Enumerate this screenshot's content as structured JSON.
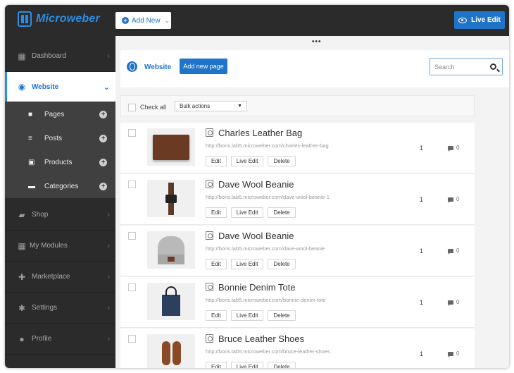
{
  "topbar": {
    "logo_text": "Microweber",
    "add_new_label": "Add New",
    "live_edit_label": "Live Edit"
  },
  "sidebar": {
    "items": [
      {
        "label": "Dashboard",
        "icon": "dashboard-icon"
      },
      {
        "label": "Website",
        "icon": "globe-icon"
      },
      {
        "label": "Shop",
        "icon": "shop-icon"
      },
      {
        "label": "My Modules",
        "icon": "modules-icon"
      },
      {
        "label": "Marketplace",
        "icon": "puzzle-icon"
      },
      {
        "label": "Settings",
        "icon": "gear-icon"
      },
      {
        "label": "Profile",
        "icon": "user-icon"
      }
    ],
    "sub_items": [
      {
        "label": "Pages",
        "icon": "page-icon"
      },
      {
        "label": "Posts",
        "icon": "posts-icon"
      },
      {
        "label": "Products",
        "icon": "products-icon"
      },
      {
        "label": "Categories",
        "icon": "folder-icon"
      }
    ]
  },
  "header": {
    "title": "Website",
    "add_page_label": "Add new page",
    "search_placeholder": "Search"
  },
  "toolbar": {
    "check_all_label": "Check all",
    "bulk_actions_label": "Bulk actions"
  },
  "buttons": {
    "edit": "Edit",
    "live_edit": "Live Edit",
    "delete": "Delete"
  },
  "products": [
    {
      "title": "Charles Leather Bag",
      "url": "http://boris.lab5.microweber.com/charles-leather-bag",
      "count": "1",
      "comments": "0",
      "thumb": "bag"
    },
    {
      "title": "Dave Wool Beanie",
      "url": "http://boris.lab5.microweber.com/dave-wool-beanie-1",
      "count": "1",
      "comments": "0",
      "thumb": "watch"
    },
    {
      "title": "Dave Wool Beanie",
      "url": "http://boris.lab5.microweber.com/dave-wool-beanie",
      "count": "1",
      "comments": "0",
      "thumb": "beanie"
    },
    {
      "title": "Bonnie Denim Tote",
      "url": "http://boris.lab5.microweber.com/bonnie-denim-tote",
      "count": "1",
      "comments": "0",
      "thumb": "tote"
    },
    {
      "title": "Bruce Leather Shoes",
      "url": "http://boris.lab5.microweber.com/bruce-leather-shoes",
      "count": "1",
      "comments": "0",
      "thumb": "shoes"
    }
  ],
  "colors": {
    "accent": "#1f74c9",
    "sidebar_bg": "#2b2b2b",
    "submenu_bg": "#404040"
  }
}
